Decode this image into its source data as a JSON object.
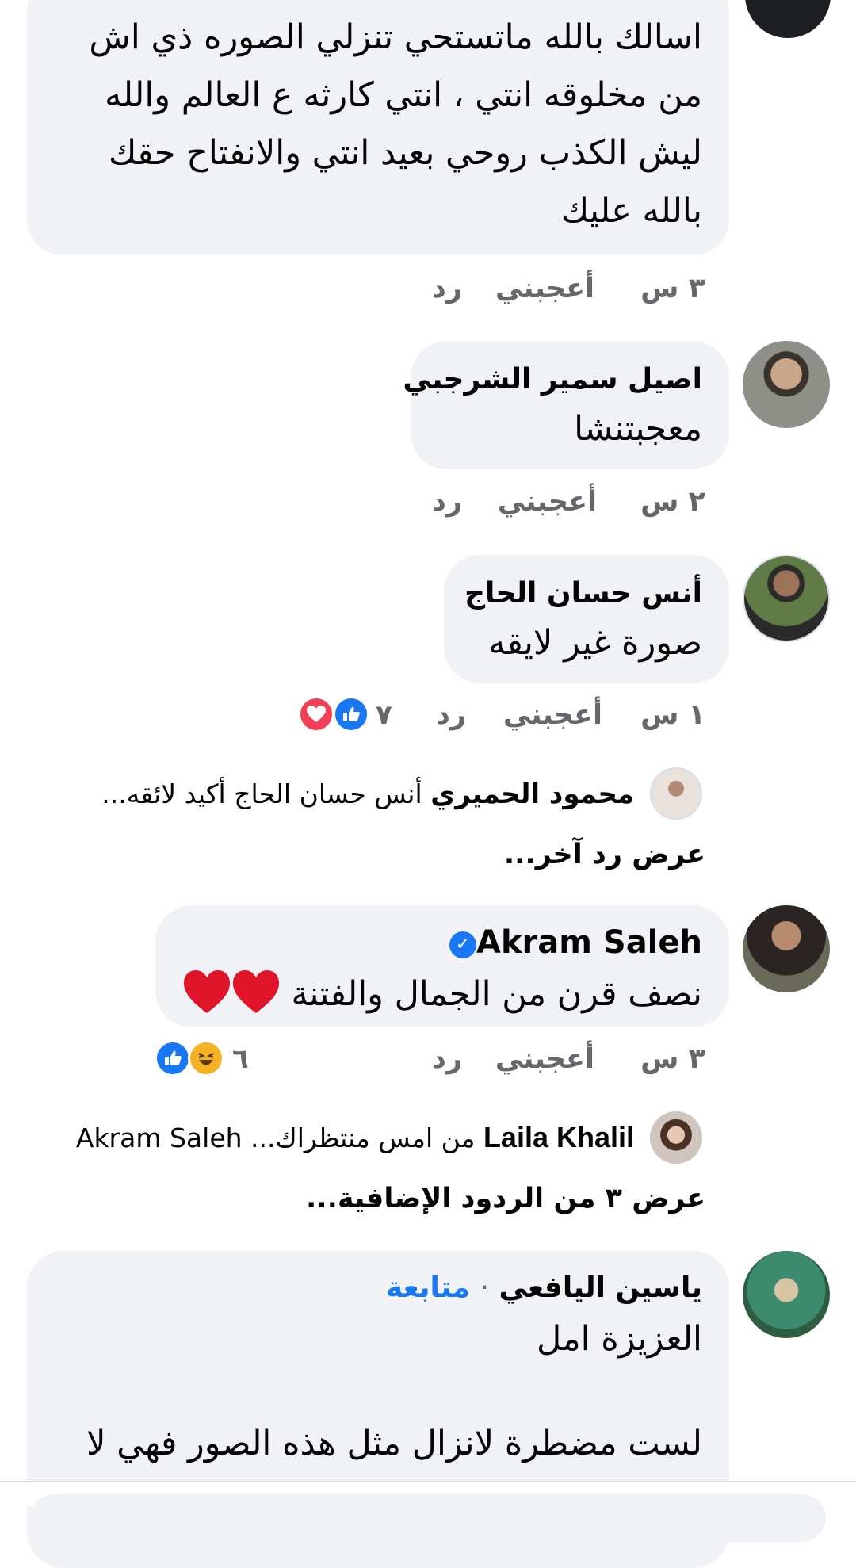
{
  "comments": [
    {
      "body_lines": [
        "اسالك بالله ماتستحي تنزلي الصوره ذي  اش",
        "من مخلوقه انتي ،  انتي كارثه ع العالم والله",
        "ليش الكذب  روحي بعيد انتي والانفتاح حقك",
        "بالله عليك"
      ],
      "time": "٣ س",
      "like": "أعجبني",
      "reply": "رد"
    },
    {
      "author": "اصيل سمير الشرجبي",
      "body_lines": [
        "معجبتنشا"
      ],
      "time": "٢ س",
      "like": "أعجبني",
      "reply": "رد"
    },
    {
      "author": "أنس حسان الحاج",
      "body_lines": [
        "صورة غير لايقه"
      ],
      "time": "١ س",
      "like": "أعجبني",
      "reply": "رد",
      "reaction_count": "٧",
      "reactions": [
        "heart-reaction-icon",
        "like-reaction-icon"
      ],
      "reply_preview": {
        "name": "محمود الحميري",
        "text": "أنس حسان الحاج أكيد لائقه..."
      },
      "view_more": "عرض رد آخر..."
    },
    {
      "author": "Akram Saleh",
      "verified": true,
      "body_lines": [
        "نصف قرن من الجمال والفتنة"
      ],
      "time": "٣ س",
      "like": "أعجبني",
      "reply": "رد",
      "reaction_count": "٦",
      "reactions": [
        "haha-reaction-icon",
        "like-reaction-icon"
      ],
      "reply_preview": {
        "name": "Laila Khalil",
        "text": "من امس منتظراك...  Akram Saleh"
      },
      "view_more": "عرض ٣ من الردود الإضافية..."
    },
    {
      "author": "ياسين اليافعي",
      "separator": "·",
      "follow": "متابعة",
      "body_lines": [
        "العزيزة  امل",
        "",
        "لست مضطرة لانزال مثل هذه الصور فهي لا"
      ]
    }
  ],
  "colors": {
    "bubble": "#f0f2f5",
    "meta": "#65676b",
    "accent": "#1877f2",
    "heart": "#f33e58"
  }
}
